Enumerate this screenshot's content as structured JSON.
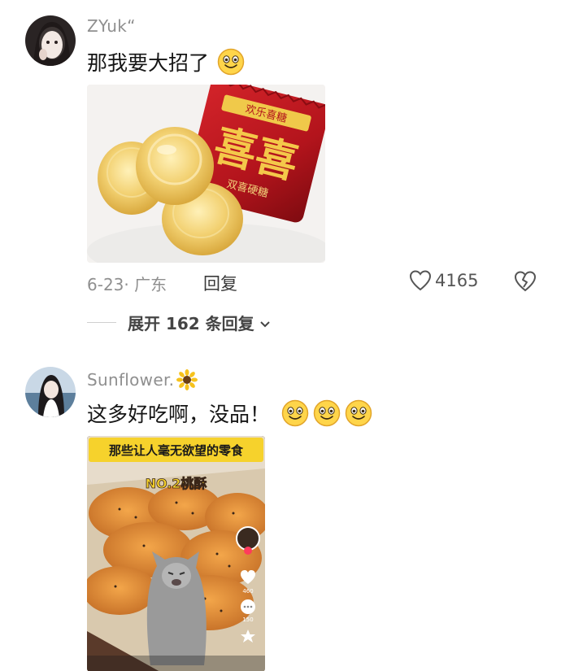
{
  "comments": [
    {
      "username": "ZYuk“",
      "text": "那我要大招了",
      "emojis": [
        "grinning-face",
        "grinning-face-emoji"
      ],
      "meta": "6-23· 广东",
      "reply_label": "回复",
      "likes": "4165",
      "expand_label": "展开 162 条回复",
      "image": {
        "wrapper_text": "喜喜",
        "wrapper_small": "欢乐喜糖",
        "wrapper_sub": "双喜硬糖"
      }
    },
    {
      "username": "Sunflower.",
      "username_suffix_icon": "sunflower-icon",
      "text": "这多好吃啊，没品！",
      "emojis": [
        "grinning-face",
        "grinning-face",
        "grinning-face"
      ],
      "image": {
        "banner": "那些让人毫无欲望的零食",
        "label": "NO.2桃酥",
        "side_count_1": "460",
        "side_count_2": "150"
      }
    }
  ],
  "colors": {
    "username": "#8f8f8f",
    "text": "#161616",
    "candy_wrapper": "#b3141c",
    "banner_yellow": "#f6d22c"
  }
}
